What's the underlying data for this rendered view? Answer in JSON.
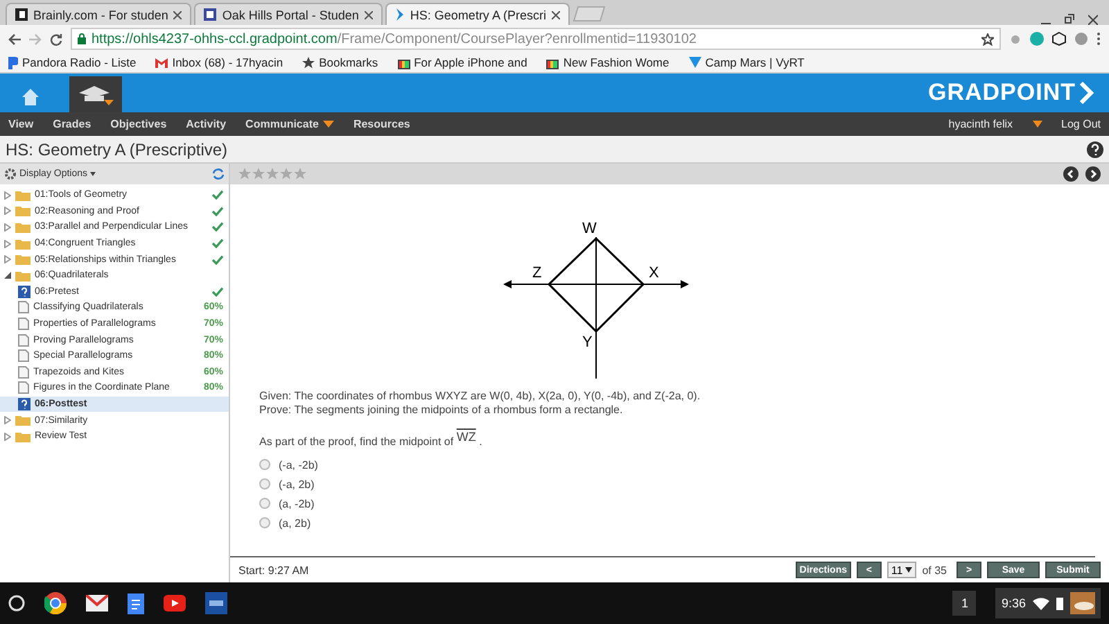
{
  "browser": {
    "tabs": [
      {
        "title": "Brainly.com - For studen",
        "selected": false
      },
      {
        "title": "Oak Hills Portal - Studen",
        "selected": false
      },
      {
        "title": "HS: Geometry A (Prescri",
        "selected": true
      }
    ],
    "url": {
      "host": "https://ohls4237-ohhs-ccl.gradpoint.com",
      "path": "/Frame/Component/CoursePlayer?enrollmentid=11930102"
    },
    "bookmarks": [
      "Pandora Radio - Liste",
      "Inbox (68) - 17hyacin",
      "Bookmarks",
      "For Apple iPhone and",
      "New Fashion Wome",
      "Camp Mars | VyRT"
    ]
  },
  "app": {
    "brand": "GRADPOINT",
    "nav": [
      {
        "label": "View",
        "dropdown": false
      },
      {
        "label": "Grades",
        "dropdown": false
      },
      {
        "label": "Objectives",
        "dropdown": false
      },
      {
        "label": "Activity",
        "dropdown": false
      },
      {
        "label": "Communicate",
        "dropdown": true
      },
      {
        "label": "Resources",
        "dropdown": false
      }
    ],
    "user": "hyacinth felix",
    "logout": "Log Out",
    "course_title": "HS: Geometry A (Prescriptive)"
  },
  "sidebar": {
    "display_options": "Display Options",
    "items": [
      {
        "kind": "folder",
        "label": "01:Tools of Geometry",
        "expanded": false,
        "completed": true,
        "selected": false
      },
      {
        "kind": "folder",
        "label": "02:Reasoning and Proof",
        "expanded": false,
        "completed": true,
        "selected": false
      },
      {
        "kind": "folder",
        "label": "03:Parallel and Perpendicular Lines",
        "expanded": false,
        "completed": true,
        "selected": false
      },
      {
        "kind": "folder",
        "label": "04:Congruent Triangles",
        "expanded": false,
        "completed": true,
        "selected": false
      },
      {
        "kind": "folder",
        "label": "05:Relationships within Triangles",
        "expanded": false,
        "completed": true,
        "selected": false
      },
      {
        "kind": "folder",
        "label": "06:Quadrilaterals",
        "expanded": true,
        "completed": false,
        "selected": false,
        "children": [
          {
            "kind": "test",
            "label": "06:Pretest",
            "completed": true,
            "selected": false
          },
          {
            "kind": "lesson",
            "label": "Classifying Quadrilaterals",
            "score": "60%",
            "completed": false,
            "selected": false
          },
          {
            "kind": "lesson",
            "label": "Properties of Parallelograms",
            "score": "70%",
            "completed": false,
            "selected": false
          },
          {
            "kind": "lesson",
            "label": "Proving Parallelograms",
            "score": "70%",
            "completed": false,
            "selected": false
          },
          {
            "kind": "lesson",
            "label": "Special Parallelograms",
            "score": "80%",
            "completed": false,
            "selected": false
          },
          {
            "kind": "lesson",
            "label": "Trapezoids and Kites",
            "score": "60%",
            "completed": false,
            "selected": false
          },
          {
            "kind": "lesson",
            "label": "Figures in the Coordinate Plane",
            "score": "80%",
            "completed": false,
            "selected": false
          },
          {
            "kind": "test",
            "label": "06:Posttest",
            "completed": false,
            "selected": true
          }
        ]
      },
      {
        "kind": "folder",
        "label": "07:Similarity",
        "expanded": false,
        "completed": false,
        "selected": false
      },
      {
        "kind": "folder",
        "label": "Review Test",
        "expanded": false,
        "completed": false,
        "selected": false
      }
    ]
  },
  "question": {
    "stars": 0,
    "labels": {
      "top": "W",
      "right": "X",
      "bottom": "Y",
      "left": "Z"
    },
    "given": "Given: The coordinates of rhombus WXYZ are W(0, 4b), X(2a, 0), Y(0, -4b), and Z(-2a, 0).",
    "prove": "Prove: The segments joining the midpoints of a rhombus form a rectangle.",
    "prompt": "As part of the proof, find the midpoint of",
    "segment": "WZ",
    "prompt_end": ".",
    "options": [
      {
        "label": "(-a, -2b)",
        "selected": false
      },
      {
        "label": "(-a, 2b)",
        "selected": false
      },
      {
        "label": "(a, -2b)",
        "selected": false
      },
      {
        "label": "(a, 2b)",
        "selected": false
      }
    ]
  },
  "footer": {
    "start": "Start: 9:27 AM",
    "directions": "Directions",
    "prev": "<",
    "page": "11",
    "of": "of 35",
    "next": ">",
    "save": "Save",
    "submit": "Submit"
  },
  "taskbar": {
    "count": "1",
    "time": "9:36"
  }
}
